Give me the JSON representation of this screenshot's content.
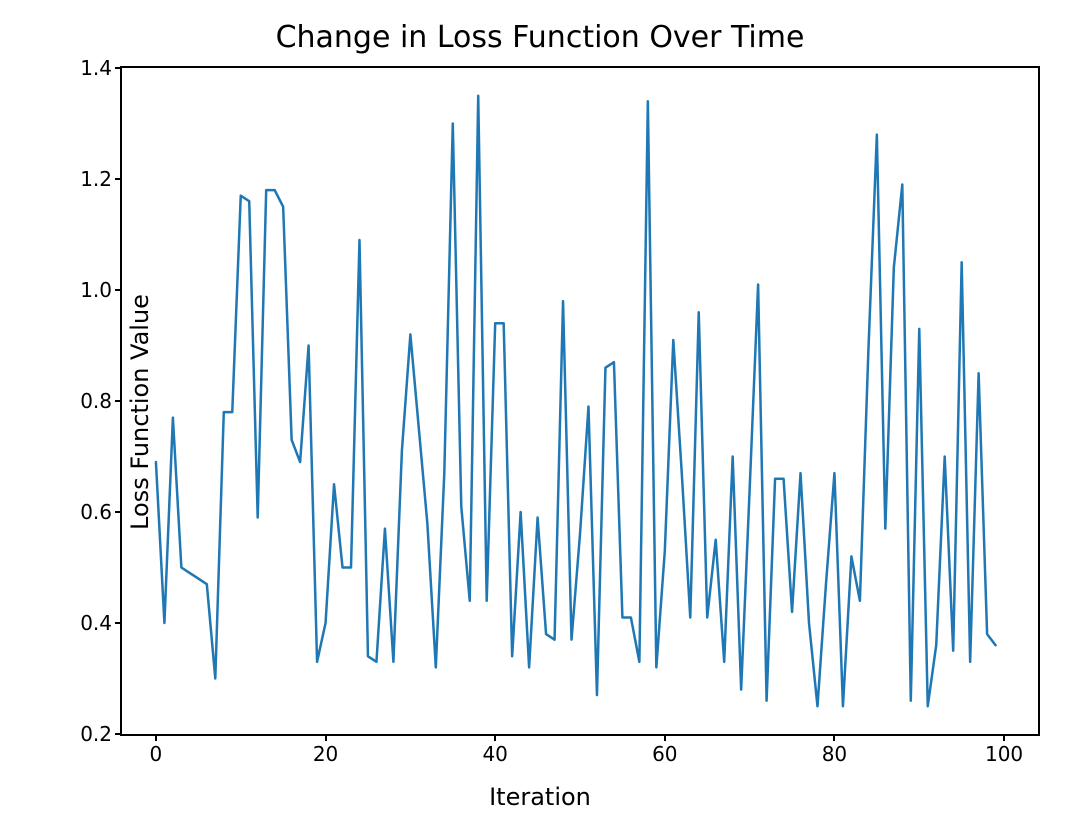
{
  "chart_data": {
    "type": "line",
    "title": "Change in Loss Function Over Time",
    "xlabel": "Iteration",
    "ylabel": "Loss Function Value",
    "xlim": [
      -4,
      104
    ],
    "ylim": [
      0.2,
      1.4
    ],
    "xticks": [
      0,
      20,
      40,
      60,
      80,
      100
    ],
    "yticks": [
      0.2,
      0.4,
      0.6,
      0.8,
      1.0,
      1.2,
      1.4
    ],
    "line_color": "#1f77b4",
    "x": [
      0,
      1,
      2,
      3,
      4,
      5,
      6,
      7,
      8,
      9,
      10,
      11,
      12,
      13,
      14,
      15,
      16,
      17,
      18,
      19,
      20,
      21,
      22,
      23,
      24,
      25,
      26,
      27,
      28,
      29,
      30,
      31,
      32,
      33,
      34,
      35,
      36,
      37,
      38,
      39,
      40,
      41,
      42,
      43,
      44,
      45,
      46,
      47,
      48,
      49,
      50,
      51,
      52,
      53,
      54,
      55,
      56,
      57,
      58,
      59,
      60,
      61,
      62,
      63,
      64,
      65,
      66,
      67,
      68,
      69,
      70,
      71,
      72,
      73,
      74,
      75,
      76,
      77,
      78,
      79,
      80,
      81,
      82,
      83,
      84,
      85,
      86,
      87,
      88,
      89,
      90,
      91,
      92,
      93,
      94,
      95,
      96,
      97,
      98,
      99
    ],
    "values": [
      0.69,
      0.4,
      0.77,
      0.5,
      0.49,
      0.48,
      0.47,
      0.3,
      0.78,
      0.78,
      1.17,
      1.16,
      0.59,
      1.18,
      1.18,
      1.15,
      0.73,
      0.69,
      0.9,
      0.33,
      0.4,
      0.65,
      0.5,
      0.5,
      1.09,
      0.34,
      0.33,
      0.57,
      0.33,
      0.71,
      0.92,
      0.75,
      0.58,
      0.32,
      0.67,
      1.3,
      0.61,
      0.44,
      1.35,
      0.44,
      0.94,
      0.94,
      0.34,
      0.6,
      0.32,
      0.59,
      0.38,
      0.37,
      0.98,
      0.37,
      0.56,
      0.79,
      0.27,
      0.86,
      0.87,
      0.41,
      0.41,
      0.33,
      1.34,
      0.32,
      0.53,
      0.91,
      0.67,
      0.41,
      0.96,
      0.41,
      0.55,
      0.33,
      0.7,
      0.28,
      0.64,
      1.01,
      0.26,
      0.66,
      0.66,
      0.42,
      0.67,
      0.4,
      0.25,
      0.47,
      0.67,
      0.25,
      0.52,
      0.44,
      0.89,
      1.28,
      0.57,
      1.04,
      1.19,
      0.26,
      0.93,
      0.25,
      0.36,
      0.7,
      0.35,
      1.05,
      0.33,
      0.85,
      0.38,
      0.36
    ]
  }
}
